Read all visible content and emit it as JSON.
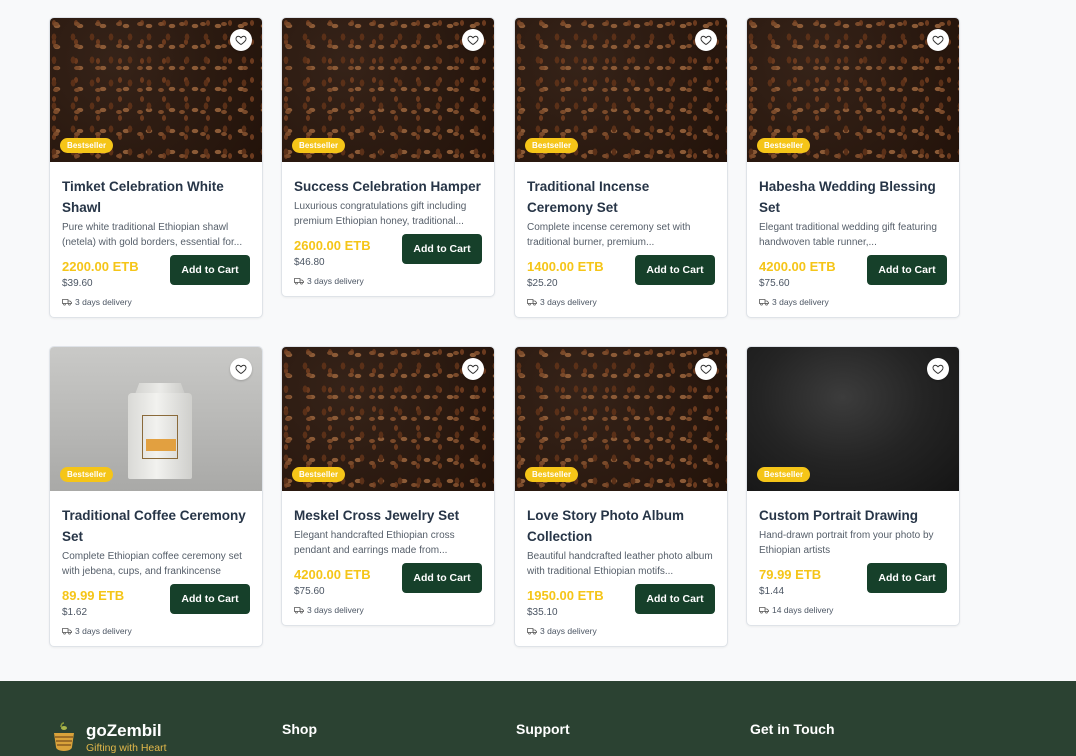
{
  "products": [
    {
      "title": "Timket Celebration White Shawl",
      "desc": "Pure white traditional Ethiopian shawl (netela) with gold borders, essential for...",
      "price": "2200.00 ETB",
      "usd": "$39.60",
      "delivery": "3 days delivery",
      "badge": "Bestseller",
      "cart": "Add to Cart",
      "image": "coffee-beans"
    },
    {
      "title": "Success Celebration Hamper",
      "desc": "Luxurious congratulations gift including premium Ethiopian honey, traditional...",
      "price": "2600.00 ETB",
      "usd": "$46.80",
      "delivery": "3 days delivery",
      "badge": "Bestseller",
      "cart": "Add to Cart",
      "image": "coffee-beans"
    },
    {
      "title": "Traditional Incense Ceremony Set",
      "desc": "Complete incense ceremony set with traditional burner, premium...",
      "price": "1400.00 ETB",
      "usd": "$25.20",
      "delivery": "3 days delivery",
      "badge": "Bestseller",
      "cart": "Add to Cart",
      "image": "coffee-beans"
    },
    {
      "title": "Habesha Wedding Blessing Set",
      "desc": "Elegant traditional wedding gift featuring handwoven table runner,...",
      "price": "4200.00 ETB",
      "usd": "$75.60",
      "delivery": "3 days delivery",
      "badge": "Bestseller",
      "cart": "Add to Cart",
      "image": "coffee-beans"
    },
    {
      "title": "Traditional Coffee Ceremony Set",
      "desc": "Complete Ethiopian coffee ceremony set with jebena, cups, and frankincense",
      "price": "89.99 ETB",
      "usd": "$1.62",
      "delivery": "3 days delivery",
      "badge": "Bestseller",
      "cart": "Add to Cart",
      "image": "coffee-bag"
    },
    {
      "title": "Meskel Cross Jewelry Set",
      "desc": "Elegant handcrafted Ethiopian cross pendant and earrings made from...",
      "price": "4200.00 ETB",
      "usd": "$75.60",
      "delivery": "3 days delivery",
      "badge": "Bestseller",
      "cart": "Add to Cart",
      "image": "coffee-beans"
    },
    {
      "title": "Love Story Photo Album Collection",
      "desc": "Beautiful handcrafted leather photo album with traditional Ethiopian motifs...",
      "price": "1950.00 ETB",
      "usd": "$35.10",
      "delivery": "3 days delivery",
      "badge": "Bestseller",
      "cart": "Add to Cart",
      "image": "coffee-beans"
    },
    {
      "title": "Custom Portrait Drawing",
      "desc": "Hand-drawn portrait from your photo by Ethiopian artists",
      "price": "79.99 ETB",
      "usd": "$1.44",
      "delivery": "14 days delivery",
      "badge": "Bestseller",
      "cart": "Add to Cart",
      "image": "dark-texture"
    }
  ],
  "footer": {
    "brand": "goZembil",
    "tagline": "Gifting with Heart",
    "shop": "Shop",
    "support": "Support",
    "contact": "Get in Touch"
  },
  "colors": {
    "accent": "#f5c518",
    "button": "#16402a",
    "footer_bg": "#2b4232"
  }
}
